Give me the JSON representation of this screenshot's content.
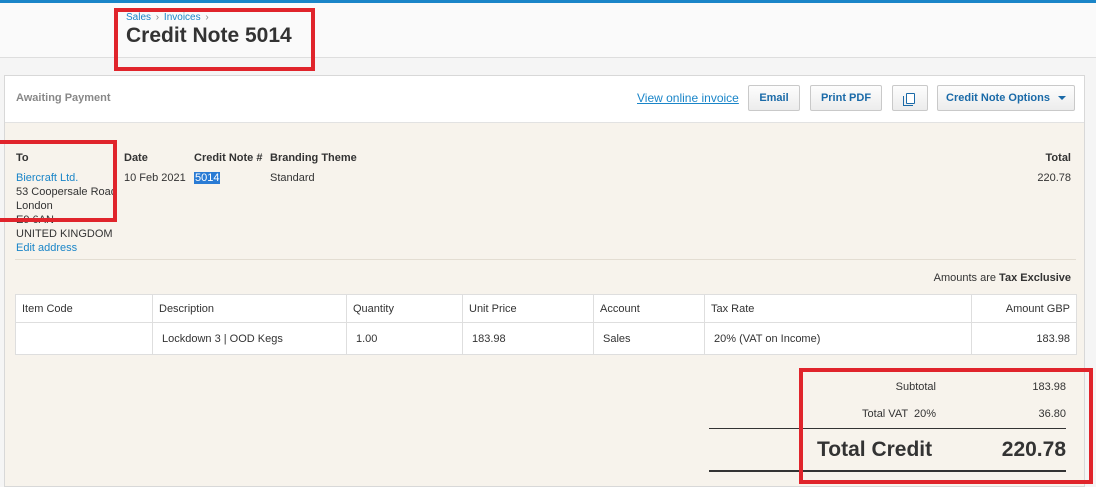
{
  "breadcrumb": {
    "sales": "Sales",
    "invoices": "Invoices",
    "sep": "›"
  },
  "page_title": "Credit Note 5014",
  "status": "Awaiting Payment",
  "toolbar": {
    "view_online": "View online invoice",
    "email": "Email",
    "print_pdf": "Print PDF",
    "copy_icon": "copy-icon",
    "options": "Credit Note Options"
  },
  "details": {
    "to_label": "To",
    "to_name": "Biercraft Ltd.",
    "address_line1": "53 Coopersale Road",
    "address_line2": "London",
    "address_line3": "E9 6AN",
    "address_line4": "UNITED KINGDOM",
    "edit_address": "Edit address",
    "date_label": "Date",
    "date_value": "10 Feb 2021",
    "number_label": "Credit Note #",
    "number_value": "5014",
    "branding_label": "Branding Theme",
    "branding_value": "Standard",
    "total_label": "Total",
    "total_value": "220.78"
  },
  "amounts_note": {
    "prefix": "Amounts are",
    "mode": "Tax Exclusive"
  },
  "table": {
    "headers": [
      "Item Code",
      "Description",
      "Quantity",
      "Unit Price",
      "Account",
      "Tax Rate",
      "Amount GBP"
    ],
    "rows": [
      [
        "",
        "Lockdown 3 | OOD Kegs",
        "1.00",
        "183.98",
        "Sales",
        "20% (VAT on Income)",
        "183.98"
      ]
    ]
  },
  "totals": {
    "subtotal_label": "Subtotal",
    "subtotal_value": "183.98",
    "vat_label": "Total VAT  20%",
    "vat_value": "36.80",
    "total_credit_label": "Total Credit",
    "total_credit_value": "220.78"
  },
  "colors": {
    "accent": "#1a85c8",
    "highlight": "#e0242b",
    "panel_bg": "#f7f3ec"
  }
}
